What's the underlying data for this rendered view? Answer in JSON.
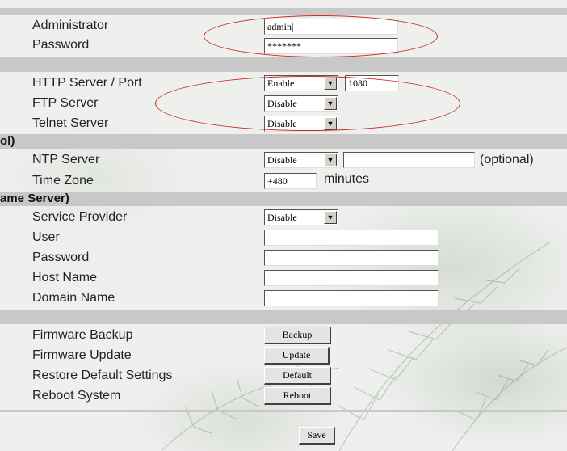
{
  "account": {
    "administrator_label": "Administrator",
    "administrator_value": "admin|",
    "password_label": "Password",
    "password_value": "*******"
  },
  "services": {
    "http_label": "HTTP Server / Port",
    "http_value": "Enable",
    "http_port": "1080",
    "ftp_label": "FTP Server",
    "ftp_value": "Disable",
    "telnet_label": "Telnet Server",
    "telnet_value": "Disable"
  },
  "time": {
    "section_label": "ol)",
    "ntp_label": "NTP Server",
    "ntp_value": "Disable",
    "ntp_server": "",
    "optional_text": "(optional)",
    "tz_label": "Time Zone",
    "tz_value": "+480",
    "tz_unit": "minutes"
  },
  "ddns": {
    "section_label": "ame Server)",
    "provider_label": "Service Provider",
    "provider_value": "Disable",
    "user_label": "User",
    "user_value": "",
    "password_label": "Password",
    "password_value": "",
    "host_label": "Host Name",
    "host_value": "",
    "domain_label": "Domain Name",
    "domain_value": ""
  },
  "maintenance": {
    "backup_label": "Firmware Backup",
    "backup_button": "Backup",
    "update_label": "Firmware Update",
    "update_button": "Update",
    "restore_label": "Restore Default Settings",
    "restore_button": "Default",
    "reboot_label": "Reboot System",
    "reboot_button": "Reboot"
  },
  "save_button": "Save",
  "colors": {
    "section_bar": "#c8c8c8",
    "annotation": "#cc2a2a"
  }
}
